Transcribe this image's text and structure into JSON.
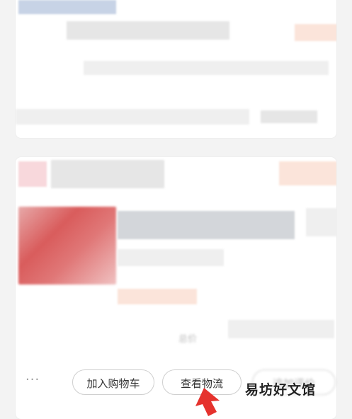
{
  "order_card": {
    "more_label": "···",
    "buttons": {
      "add_to_cart": "加入购物车",
      "view_logistics": "查看物流",
      "add_review": "追加评价"
    },
    "faint_text": "总价"
  },
  "watermark": "易坊好文馆",
  "colors": {
    "arrow": "#e5322d",
    "thumb": "#d95c5c"
  }
}
